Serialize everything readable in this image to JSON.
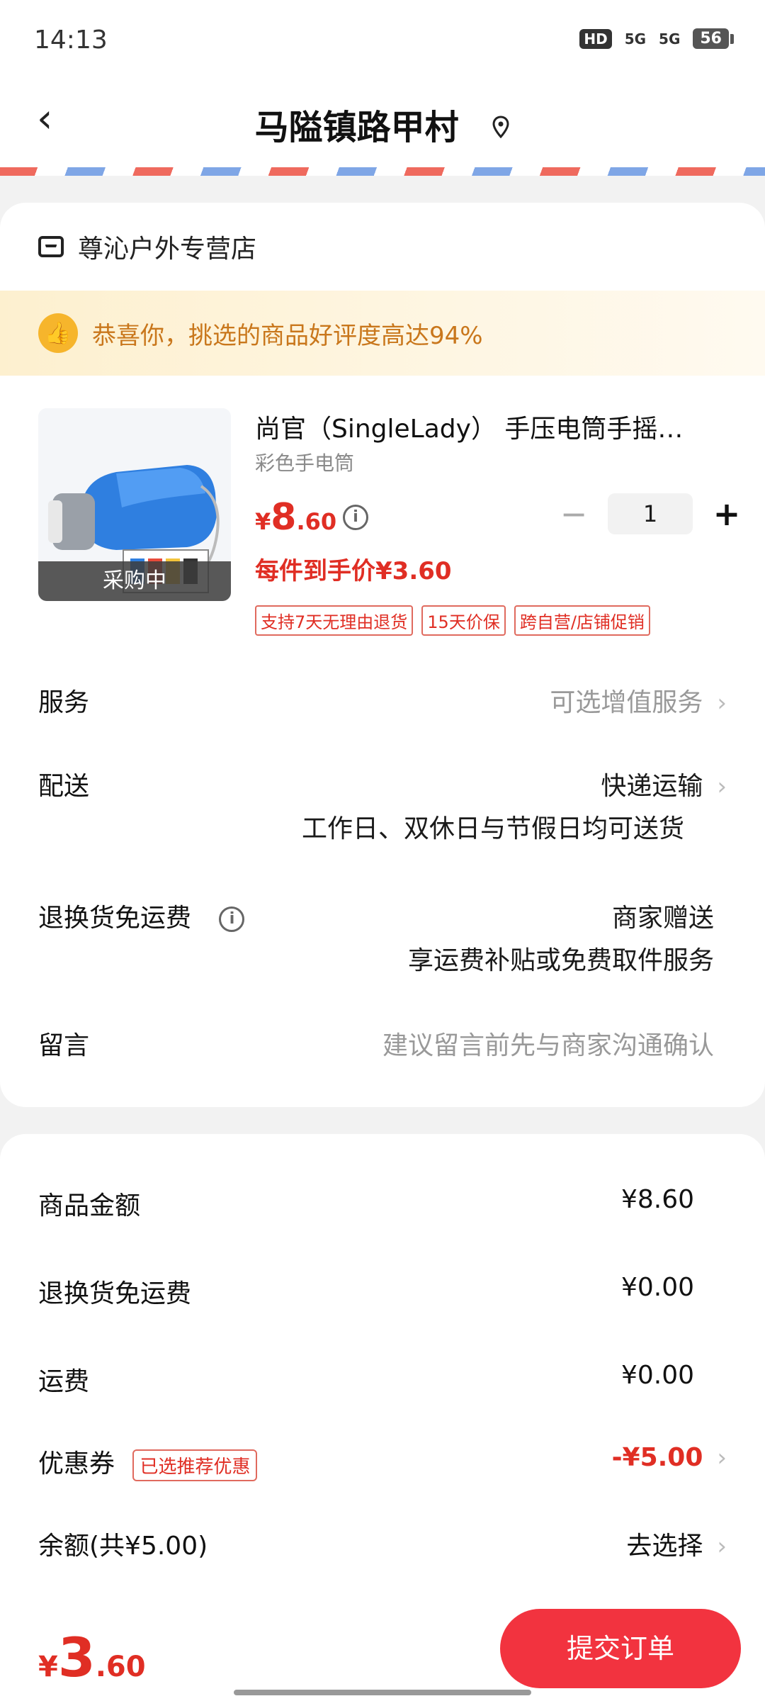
{
  "status": {
    "time": "14:13",
    "hd": "HD",
    "net1": "5G",
    "net2": "5G",
    "battery": "56"
  },
  "nav": {
    "back": "‹",
    "title": "马隘镇路甲村"
  },
  "store": {
    "name": "尊沁户外专营店"
  },
  "praise": {
    "text": "恭喜你，挑选的商品好评度高达94%"
  },
  "product": {
    "title": "尚官（SingleLady） 手压电筒手摇…",
    "subtitle": "彩色手电筒",
    "price_currency": "¥",
    "price_int": "8",
    "price_dec": ".60",
    "badge": "采购中",
    "hand_price": "每件到手价¥3.60",
    "qty": "1",
    "tags": [
      "支持7天无理由退货",
      "15天价保",
      "跨自营/店铺促销"
    ]
  },
  "rows": {
    "service_label": "服务",
    "service_value": "可选增值服务",
    "delivery_label": "配送",
    "delivery_value": "快递运输",
    "delivery_note": "工作日、双休日与节假日均可送货",
    "return_label": "退换货免运费",
    "return_value": "商家赠送",
    "return_note": "享运费补贴或免费取件服务",
    "message_label": "留言",
    "message_placeholder": "建议留言前先与商家沟通确认"
  },
  "fees": {
    "goods_label": "商品金额",
    "goods_value": "¥8.60",
    "return_fee_label": "退换货免运费",
    "return_fee_value": "¥0.00",
    "shipping_label": "运费",
    "shipping_value": "¥0.00",
    "coupon_label": "优惠券",
    "coupon_tag": "已选推荐优惠",
    "coupon_value": "-¥5.00",
    "balance_label": "余额(共¥5.00)",
    "balance_value": "去选择"
  },
  "bottom": {
    "total_currency": "¥",
    "total_int": "3",
    "total_dec": ".60",
    "submit": "提交订单"
  },
  "colors": {
    "accent": "#e02e24",
    "button": "#f2333f"
  }
}
